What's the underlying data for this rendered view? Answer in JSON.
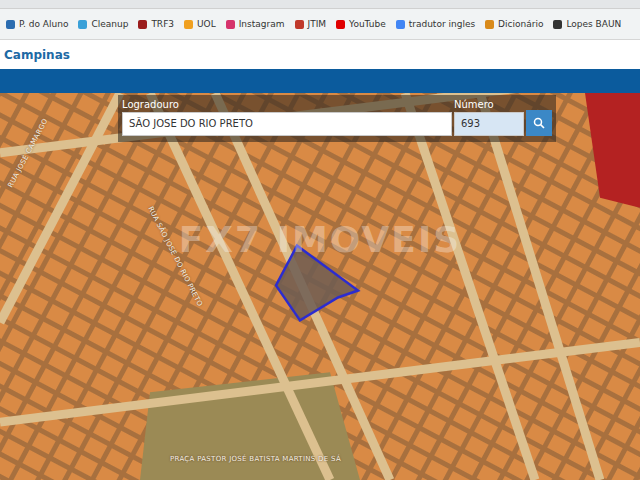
{
  "browser": {
    "bookmarks": [
      {
        "label": "P. do Aluno",
        "color": "#2b6cb0"
      },
      {
        "label": "Cleanup",
        "color": "#3aa0d8"
      },
      {
        "label": "TRF3",
        "color": "#9b1c1c"
      },
      {
        "label": "UOL",
        "color": "#f0a020"
      },
      {
        "label": "Instagram",
        "color": "#d6336c"
      },
      {
        "label": "JTIM",
        "color": "#c0392b"
      },
      {
        "label": "YouTube",
        "color": "#e00000"
      },
      {
        "label": "tradutor ingles",
        "color": "#4285f4"
      },
      {
        "label": "Dicionário",
        "color": "#d98a1a"
      },
      {
        "label": "Lopes BAUN",
        "color": "#333333"
      }
    ]
  },
  "header": {
    "title": "Campinas"
  },
  "search": {
    "street_label": "Logradouro",
    "street_value": "SÃO JOSE DO RIO PRETO",
    "number_label": "Número",
    "number_value": "693"
  },
  "map": {
    "watermark": "FX7 IMOVEIS",
    "street_labels": [
      "RUA JOSÉ CAMARGO",
      "RUA SÃO JOSÉ DO RIO PRETO",
      "PRAÇA PASTOR JOSÉ BATISTA MARTINS DE SÁ"
    ]
  }
}
